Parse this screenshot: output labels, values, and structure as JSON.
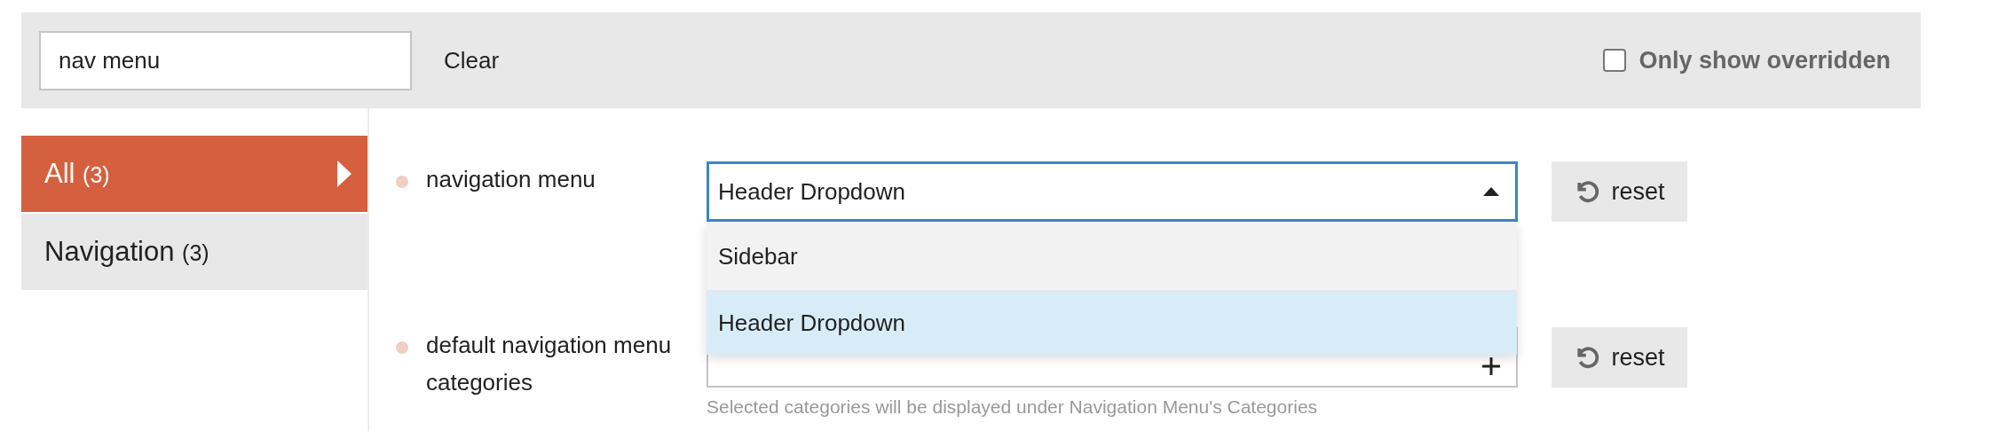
{
  "search": {
    "value": "nav menu"
  },
  "clear_button": "Clear",
  "filter": {
    "label": "Only show overridden",
    "checked": false
  },
  "sidebar": {
    "items": [
      {
        "label": "All",
        "count": "(3)",
        "selected": true
      },
      {
        "label": "Navigation",
        "count": "(3)",
        "selected": false
      }
    ]
  },
  "settings": [
    {
      "label": "navigation menu",
      "kind": "select",
      "value": "Header Dropdown",
      "expanded": true,
      "options": [
        {
          "label": "Sidebar",
          "selected": false
        },
        {
          "label": "Header Dropdown",
          "selected": true
        }
      ],
      "reset": "reset"
    },
    {
      "label": "default navigation menu categories",
      "kind": "list",
      "hint": "Selected categories will be displayed under Navigation Menu's Categories",
      "reset": "reset"
    }
  ]
}
